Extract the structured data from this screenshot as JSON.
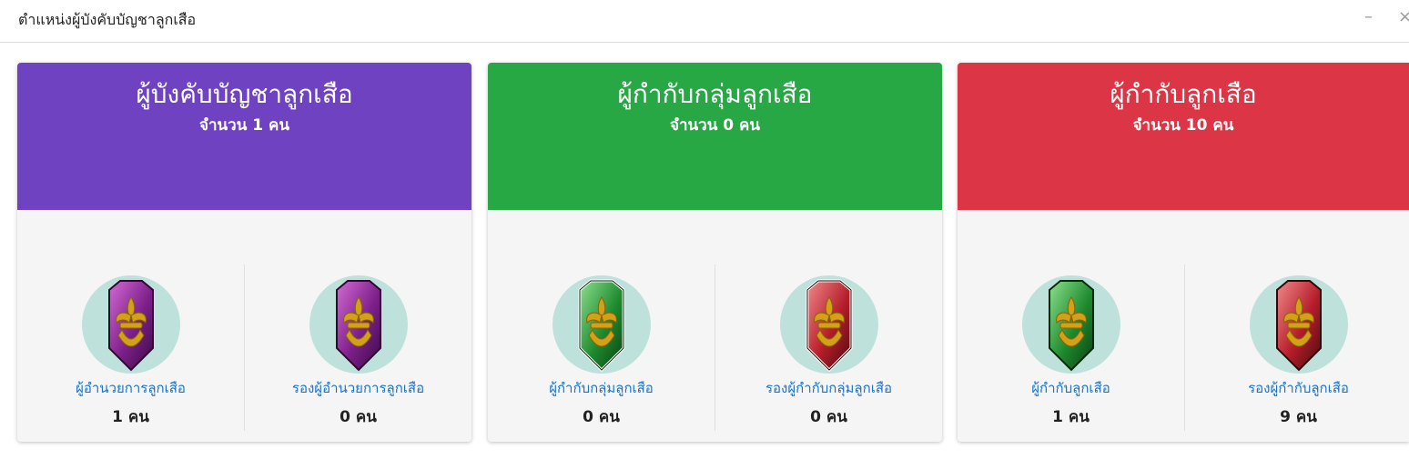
{
  "window": {
    "title": "ตำแหน่งผู้บังคับบัญชาลูกเสือ",
    "minimize_glyph": "–",
    "close_glyph": "×"
  },
  "cards": [
    {
      "title": "ผู้บังคับบัญชาลูกเสือ",
      "count": "จำนวน 1 คน",
      "color": "#6f42c1",
      "positions": [
        {
          "name": "ผู้อำนวยการลูกเสือ",
          "count": "1 คน",
          "badge": "purple-shield-badge"
        },
        {
          "name": "รองผู้อำนวยการลูกเสือ",
          "count": "0 คน",
          "badge": "purple-shield-badge"
        }
      ]
    },
    {
      "title": "ผู้กำกับกลุ่มลูกเสือ",
      "count": "จำนวน 0 คน",
      "color": "#28a745",
      "positions": [
        {
          "name": "ผู้กำกับกลุ่มลูกเสือ",
          "count": "0 คน",
          "badge": "green-shield-badge"
        },
        {
          "name": "รองผู้กำกับกลุ่มลูกเสือ",
          "count": "0 คน",
          "badge": "red-shield-badge"
        }
      ]
    },
    {
      "title": "ผู้กำกับลูกเสือ",
      "count": "จำนวน 10 คน",
      "color": "#dc3545",
      "positions": [
        {
          "name": "ผู้กำกับลูกเสือ",
          "count": "1 คน",
          "badge": "green-shield-badge"
        },
        {
          "name": "รองผู้กำกับลูกเสือ",
          "count": "9 คน",
          "badge": "red-shield-badge"
        }
      ]
    }
  ],
  "colors": {
    "link": "#1a73c9",
    "badge_circle": "#bfe1dc",
    "fleur_gold": "#d4a017"
  }
}
